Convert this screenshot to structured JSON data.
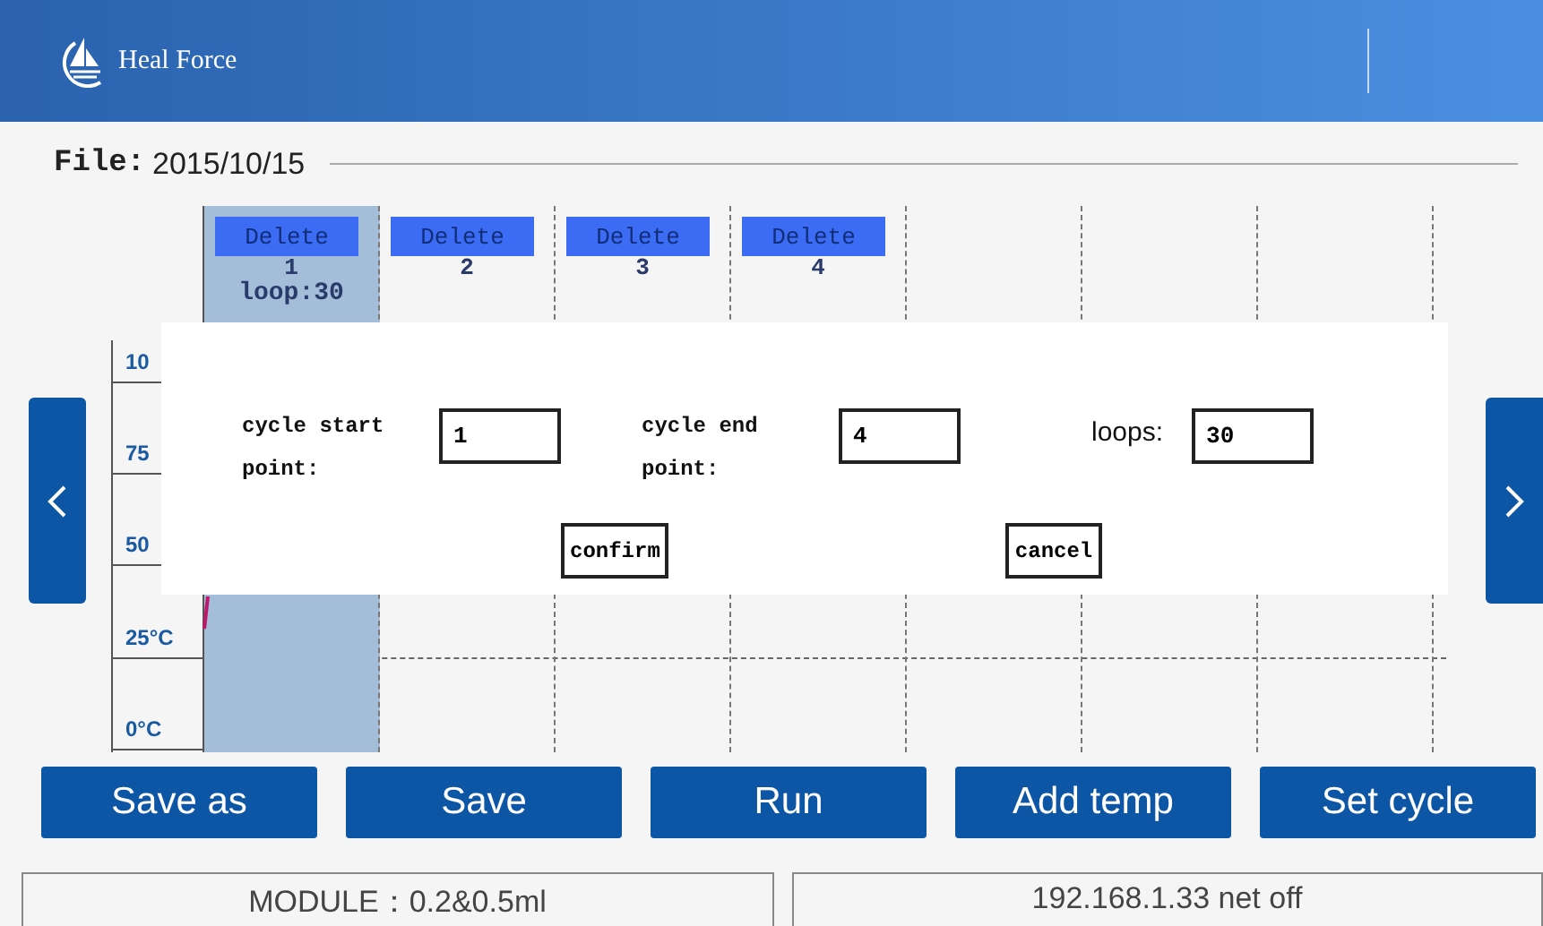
{
  "header": {
    "brand": "Heal Force"
  },
  "file": {
    "label": "File:",
    "name": "2015/10/15"
  },
  "chart": {
    "axis_labels": [
      "10",
      "75",
      "50",
      "25°C",
      "0°C"
    ],
    "steps": [
      {
        "delete": "Delete",
        "number": "1",
        "loop": "loop:30",
        "selected": true
      },
      {
        "delete": "Delete",
        "number": "2",
        "selected": false
      },
      {
        "delete": "Delete",
        "number": "3",
        "selected": false
      },
      {
        "delete": "Delete",
        "number": "4",
        "selected": false
      }
    ]
  },
  "dialog": {
    "fields": [
      {
        "kind": "mono",
        "label": "cycle start\npoint:",
        "value": "1"
      },
      {
        "kind": "mono",
        "label": "cycle end\npoint:",
        "value": "4"
      },
      {
        "kind": "sans",
        "label": "loops:",
        "value": "30"
      }
    ],
    "buttons": [
      "confirm",
      "cancel"
    ]
  },
  "buttons": [
    "Save as",
    "Save",
    "Run",
    "Add temp",
    "Set cycle"
  ],
  "status_bar": [
    "MODULE：0.2&0.5ml",
    "192.168.1.33 net off"
  ]
}
